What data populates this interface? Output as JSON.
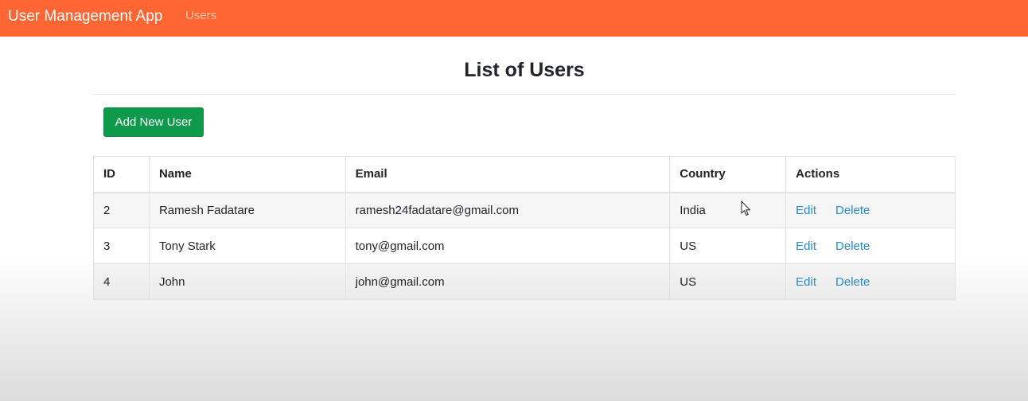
{
  "navbar": {
    "brand": "User Management App",
    "link": "Users"
  },
  "page": {
    "title": "List of Users",
    "add_button": "Add New User"
  },
  "table": {
    "headers": [
      "ID",
      "Name",
      "Email",
      "Country",
      "Actions"
    ],
    "rows": [
      {
        "id": "2",
        "name": "Ramesh Fadatare",
        "email": "ramesh24fadatare@gmail.com",
        "country": "India",
        "edit": "Edit",
        "delete": "Delete"
      },
      {
        "id": "3",
        "name": "Tony Stark",
        "email": "tony@gmail.com",
        "country": "US",
        "edit": "Edit",
        "delete": "Delete"
      },
      {
        "id": "4",
        "name": "John",
        "email": "john@gmail.com",
        "country": "US",
        "edit": "Edit",
        "delete": "Delete"
      }
    ]
  },
  "colors": {
    "navbar": "#ff6633",
    "button": "#0e9a4a",
    "link": "#2c8ac9"
  },
  "icons": {
    "cursor": "mouse-pointer-icon"
  }
}
